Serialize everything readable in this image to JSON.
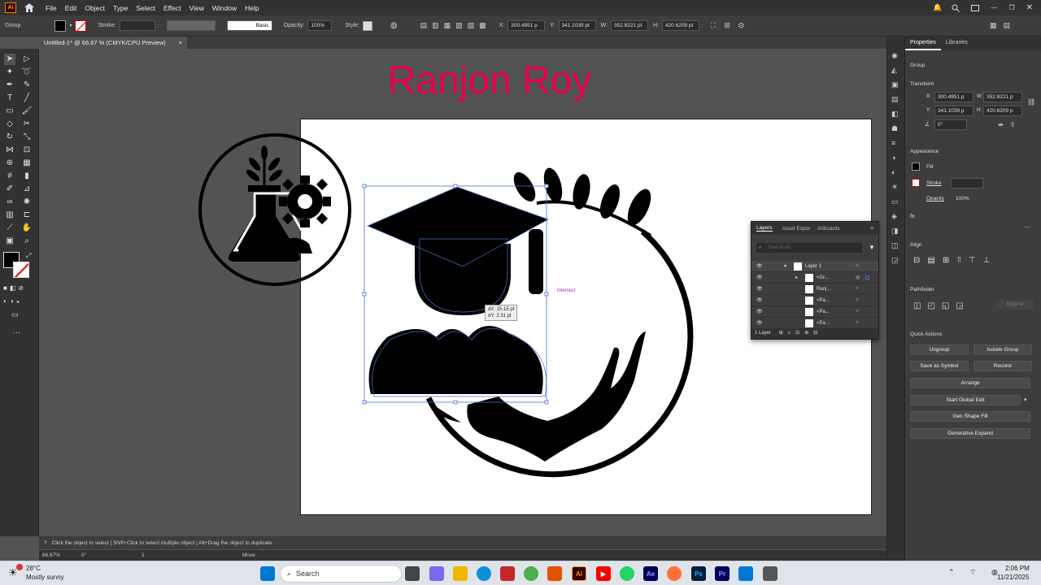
{
  "app": {
    "logo": "Ai"
  },
  "menu": [
    "File",
    "Edit",
    "Object",
    "Type",
    "Select",
    "Effect",
    "View",
    "Window",
    "Help"
  ],
  "control": {
    "selection": "Group",
    "stroke_label": "Stroke:",
    "brush": "Basic",
    "opacity_label": "Opacity:",
    "opacity": "100%",
    "style_label": "Style:",
    "x_label": "X:",
    "x": "300.4951 p",
    "y_label": "Y:",
    "y": "341.1039 pt",
    "w_label": "W:",
    "w": "352.8221 pt",
    "h_label": "H:",
    "h": "420.6209 pt"
  },
  "document": {
    "tab": "Untitled-1* @ 66.67 % (CMYK/CPU Preview)",
    "close": "×"
  },
  "canvas": {
    "watermark": "Ranjon Roy",
    "tooltip_dx": "dX: 15.15 pt",
    "tooltip_dy": "dY: 2.31 pt",
    "smart_guide": "intersect"
  },
  "status": {
    "hint": "Click the object to select  |  Shift+Click to select multiple object  |  Alt+Drag the object to duplicate",
    "zoom": "66.67%",
    "rotate": "0°",
    "artboard": "1",
    "mode": "Move"
  },
  "layers_panel": {
    "tabs": [
      "Layers",
      "Asset Expor",
      "Artboards"
    ],
    "search_placeholder": "Search All",
    "rows": [
      "Layer 1",
      "<Gr...",
      "Ranj...",
      "<Pa...",
      "<Pa...",
      "<Pa..."
    ],
    "footer": "1 Layer"
  },
  "properties": {
    "tabs": [
      "Properties",
      "Libraries"
    ],
    "selection": "Group",
    "transform_title": "Transform",
    "x_label": "X:",
    "x": "300.4951 p",
    "y_label": "Y:",
    "y": "341.1039 p",
    "w_label": "W:",
    "w": "352.8221 p",
    "h_label": "H:",
    "h": "420.6209 p",
    "angle": "0°",
    "appearance_title": "Appearance",
    "fill_label": "Fill",
    "stroke_label": "Stroke",
    "opacity_label": "Opacity",
    "opacity": "100%",
    "fx": "fx.",
    "align_title": "Align",
    "pathfinder_title": "Pathfinder",
    "expand": "Expand",
    "quick_actions_title": "Quick Actions",
    "ungroup": "Ungroup",
    "isolate_group": "Isolate Group",
    "save_symbol": "Save as Symbol",
    "recolor": "Recolor",
    "arrange": "Arrange",
    "start_global_edit": "Start Global Edit",
    "gen_shape_fill": "Gen Shape Fill",
    "generative_expand": "Generative Expand"
  },
  "taskbar": {
    "temp": "28°C",
    "weather": "Mostly sunny",
    "search": "Search",
    "time": "2:06 PM",
    "date": "11/21/2025"
  },
  "colors": {
    "accent": "#e6004c",
    "ui_dark": "#323232",
    "ui_mid": "#3d3d3d",
    "canvas": "#535353"
  }
}
